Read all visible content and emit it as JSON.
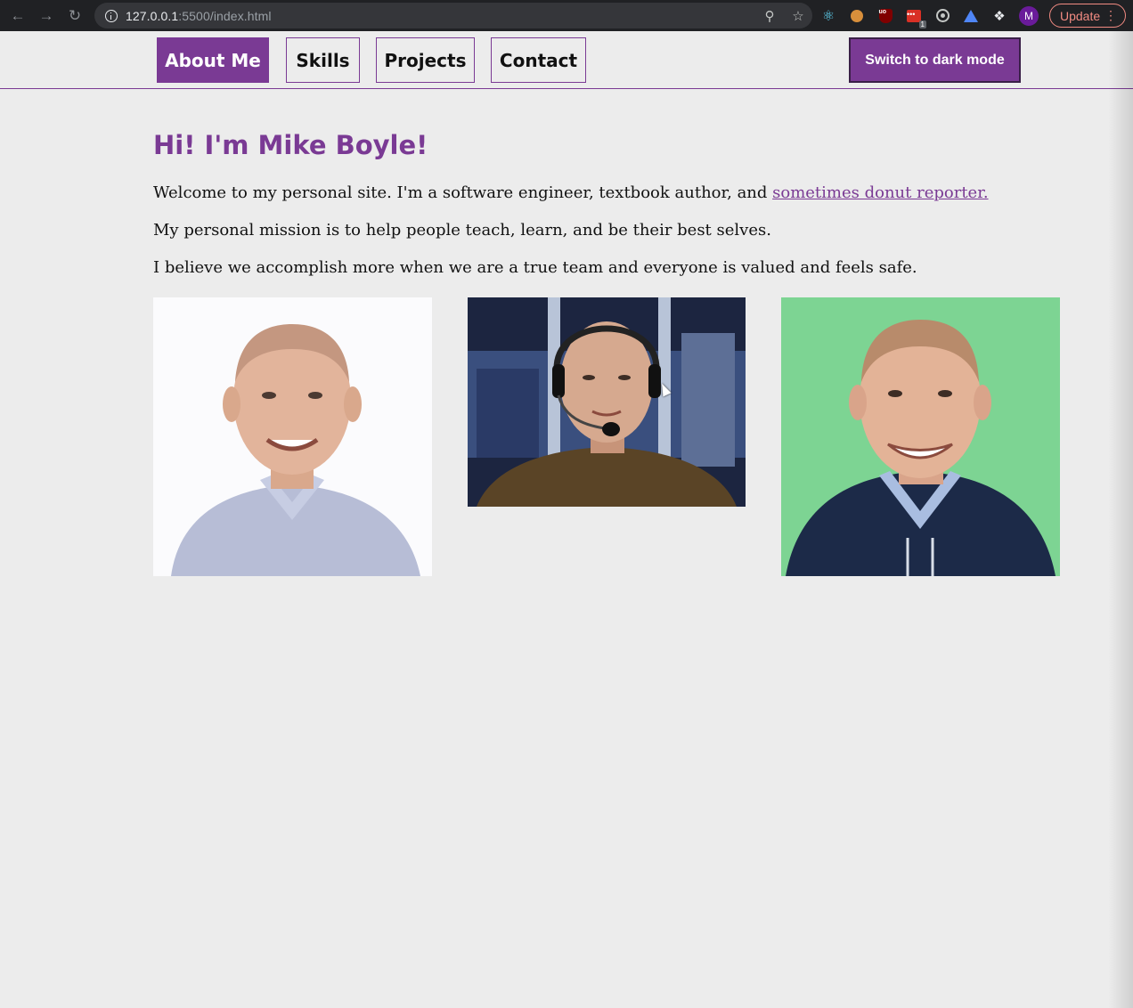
{
  "browser": {
    "url_host": "127.0.0.1",
    "url_rest": ":5500/index.html",
    "update_label": "Update",
    "avatar_letter": "M",
    "ext_badge": "1"
  },
  "nav": {
    "items": [
      {
        "label": "About Me",
        "active": true
      },
      {
        "label": "Skills",
        "active": false
      },
      {
        "label": "Projects",
        "active": false
      },
      {
        "label": "Contact",
        "active": false
      }
    ],
    "dark_mode_label": "Switch to dark mode"
  },
  "main": {
    "title": "Hi! I'm Mike Boyle!",
    "intro": "Welcome to my personal site. I'm a software engineer, textbook author, and ",
    "intro_link": "sometimes donut reporter.",
    "mission": "My personal mission is to help people teach, learn, and be their best selves.",
    "belief": "I believe we accomplish more when we are a true team and everyone is valued and feels safe."
  },
  "colors": {
    "accent": "#7a3a94",
    "page_bg": "#ececec",
    "chrome_bg": "#202124"
  }
}
